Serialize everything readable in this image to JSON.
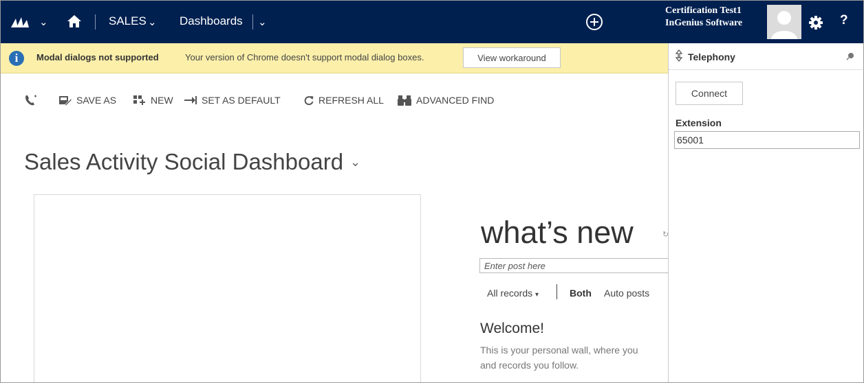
{
  "nav": {
    "area_label": "SALES",
    "section_label": "Dashboards",
    "user_name": "Certification Test1",
    "org_name": "InGenius Software",
    "help_label": "?",
    "bar_color": "#002050"
  },
  "notification": {
    "title": "Modal dialogs not supported",
    "message": "Your version of Chrome doesn't support modal dialog boxes.",
    "button_label": "View workaround",
    "info_glyph": "i",
    "background": "#fbefaa"
  },
  "commands": {
    "save_as": "SAVE AS",
    "new": "NEW",
    "set_default": "SET AS DEFAULT",
    "refresh_all": "REFRESH ALL",
    "advanced_find": "ADVANCED FIND"
  },
  "dashboard": {
    "title": "Sales Activity Social Dashboard"
  },
  "whats_new": {
    "title": "what’s new",
    "post_placeholder": "Enter post here",
    "filter_all": "All records",
    "filter_both": "Both",
    "filter_auto": "Auto posts",
    "welcome_title": "Welcome!",
    "welcome_line1": "This is your personal wall, where you",
    "welcome_line2": "and records you follow."
  },
  "telephony": {
    "title": "Telephony",
    "connect_label": "Connect",
    "extension_label": "Extension",
    "extension_value": "65001"
  },
  "icons": [
    "dynamics-logo-icon",
    "chevron-down-icon",
    "home-icon",
    "plus-circle-icon",
    "user-avatar-icon",
    "gear-icon",
    "info-icon",
    "phone-icon",
    "save-as-icon",
    "new-icon",
    "set-default-icon",
    "refresh-icon",
    "binoculars-icon",
    "pin-icon"
  ]
}
